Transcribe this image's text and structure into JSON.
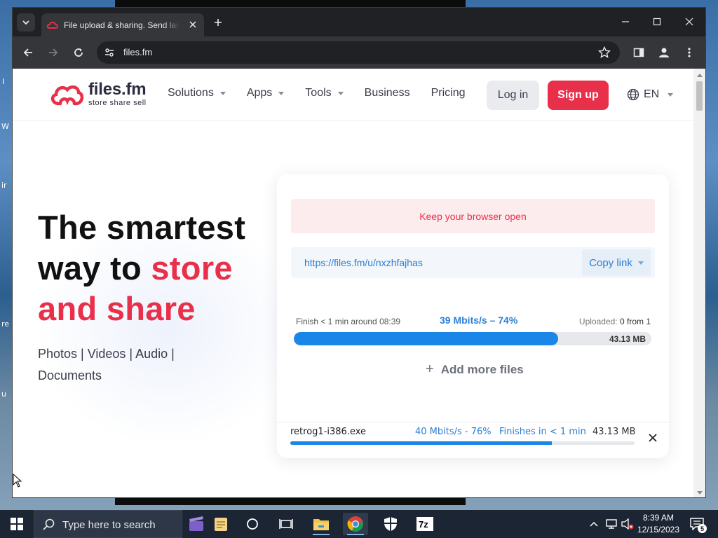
{
  "browser": {
    "tab_title": "File upload & sharing. Send large files",
    "url": "files.fm"
  },
  "site": {
    "logo_name": "files.fm",
    "logo_tagline": "store  share  sell",
    "nav": [
      {
        "label": "Solutions",
        "has_dropdown": true
      },
      {
        "label": "Apps",
        "has_dropdown": true
      },
      {
        "label": "Tools",
        "has_dropdown": true
      },
      {
        "label": "Business",
        "has_dropdown": false
      },
      {
        "label": "Pricing",
        "has_dropdown": false
      }
    ],
    "login_label": "Log in",
    "signup_label": "Sign up",
    "language": "EN",
    "brand_color": "#e8304a"
  },
  "hero": {
    "line1": "The smartest",
    "line2_plain": "way to ",
    "line2_accent": "store",
    "line3_accent": "and share",
    "subtitle": "Photos | Videos | Audio | Documents"
  },
  "upload": {
    "notice": "Keep your browser open",
    "share_link": "https://files.fm/u/nxzhfajhas",
    "copy_label": "Copy link",
    "finish_text": "Finish < 1 min around 08:39",
    "speed_text": "39 Mbits/s – 74%",
    "uploaded_label": "Uploaded:",
    "uploaded_value": "0 from 1",
    "total_size": "43.13 MB",
    "progress_fraction": 0.74,
    "add_more_label": "Add more files",
    "file": {
      "name": "retrog1-i386.exe",
      "speed": "40 Mbits/s - 76%",
      "eta": "Finishes in < 1 min",
      "size": "43.13 MB",
      "progress_fraction": 0.76
    }
  },
  "taskbar": {
    "search_placeholder": "Type here to search",
    "time": "8:39 AM",
    "date": "12/15/2023",
    "notification_count": "5"
  },
  "desktop": {
    "fragments": [
      "I",
      "W",
      "ir",
      "re",
      "u"
    ]
  }
}
